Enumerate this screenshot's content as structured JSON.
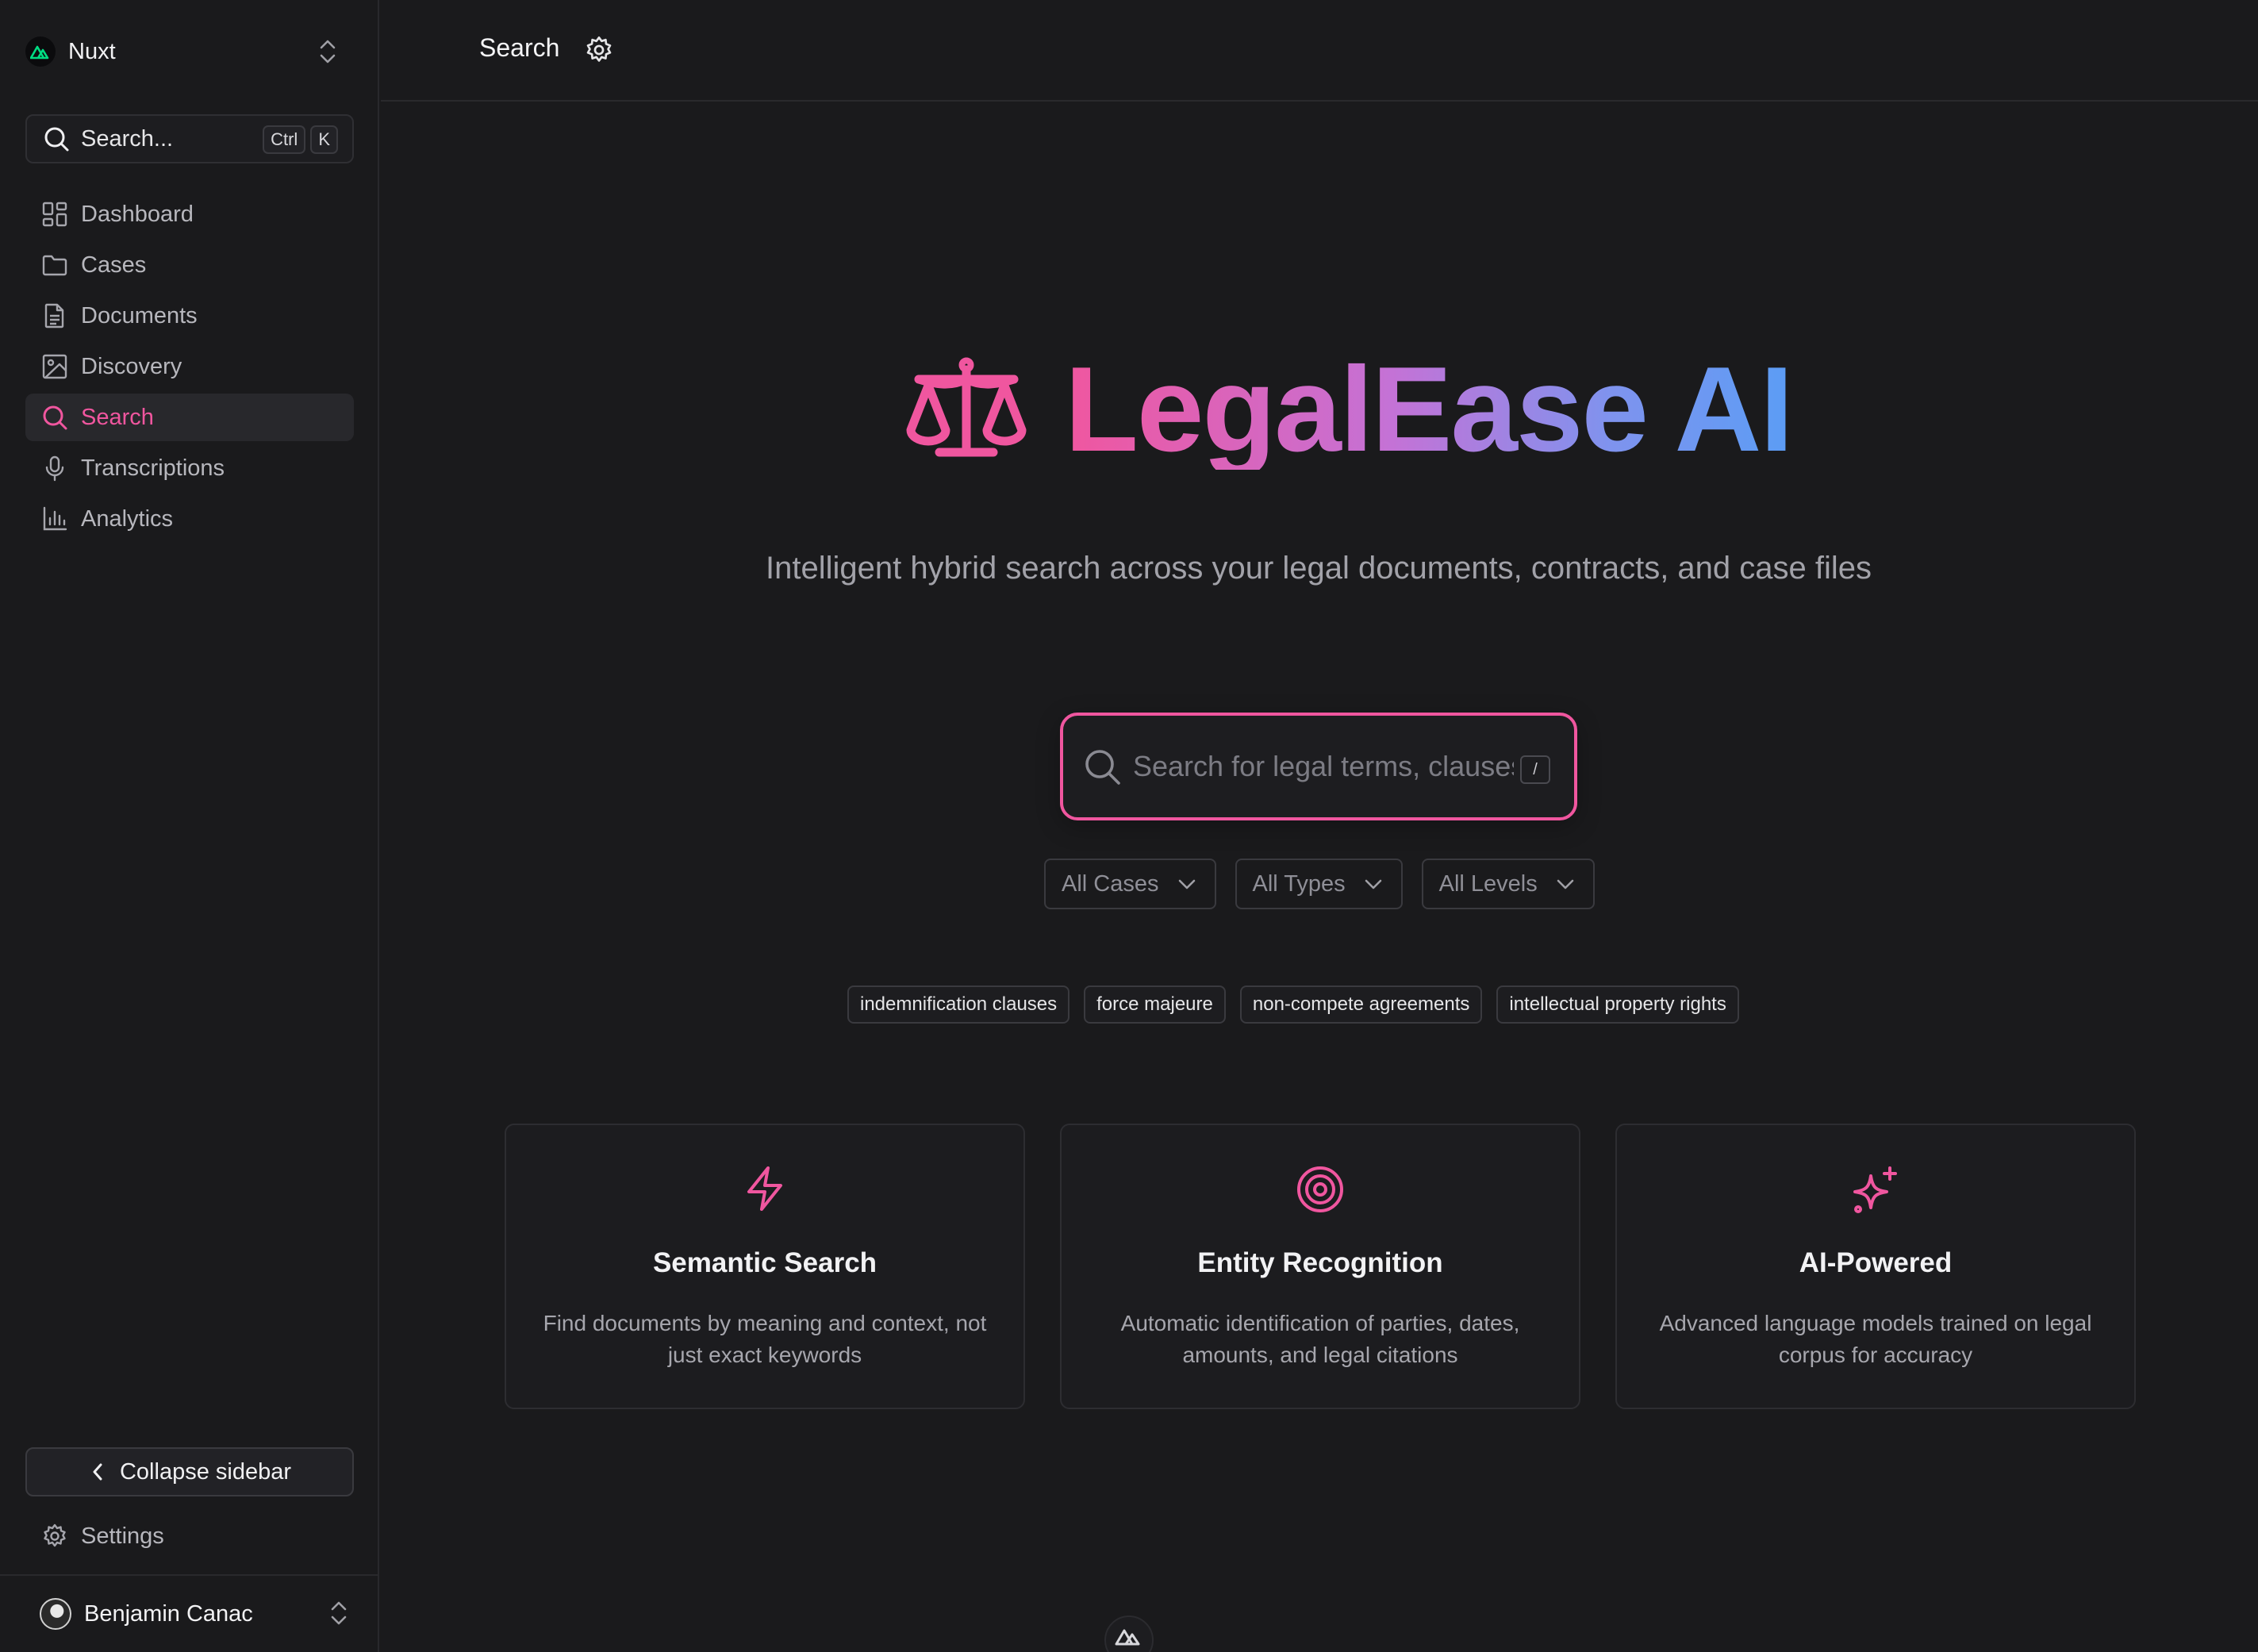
{
  "sidebar": {
    "team_name": "Nuxt",
    "search": {
      "label": "Search...",
      "kbd": [
        "Ctrl",
        "K"
      ]
    },
    "items": [
      {
        "label": "Dashboard",
        "icon": "dashboard-icon"
      },
      {
        "label": "Cases",
        "icon": "folder-icon"
      },
      {
        "label": "Documents",
        "icon": "document-icon"
      },
      {
        "label": "Discovery",
        "icon": "image-icon"
      },
      {
        "label": "Search",
        "icon": "search-icon",
        "active": true
      },
      {
        "label": "Transcriptions",
        "icon": "microphone-icon"
      },
      {
        "label": "Analytics",
        "icon": "bar-chart-icon"
      }
    ],
    "collapse_label": "Collapse sidebar",
    "settings_label": "Settings",
    "user_name": "Benjamin Canac"
  },
  "header": {
    "title": "Search"
  },
  "hero": {
    "title": "LegalEase AI",
    "subtitle": "Intelligent hybrid search across your legal documents, contracts, and case files"
  },
  "search": {
    "placeholder": "Search for legal terms, clauses, or concepts",
    "shortcut": "/"
  },
  "filters": [
    "All Cases",
    "All Types",
    "All Levels"
  ],
  "suggestions": [
    "indemnification clauses",
    "force majeure",
    "non-compete agreements",
    "intellectual property rights"
  ],
  "features": [
    {
      "icon": "lightning-bolt-icon",
      "title": "Semantic Search",
      "description": "Find documents by meaning and context, not just exact keywords"
    },
    {
      "icon": "target-icon",
      "title": "Entity Recognition",
      "description": "Automatic identification of parties, dates, amounts, and legal citations"
    },
    {
      "icon": "sparkles-icon",
      "title": "AI-Powered",
      "description": "Advanced language models trained on legal corpus for accuracy"
    }
  ],
  "colors": {
    "accent": "#f0569f",
    "gradient_end": "#5b9df5",
    "background": "#1a1a1c"
  }
}
